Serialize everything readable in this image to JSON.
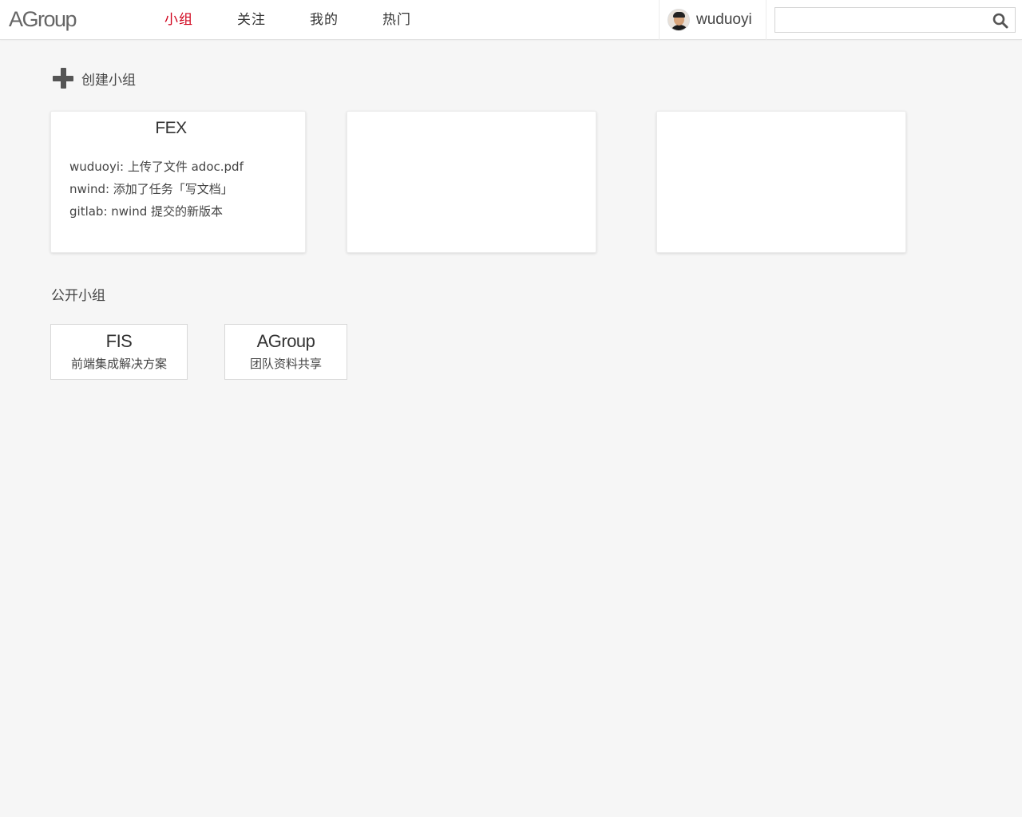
{
  "header": {
    "logo": "AGroup",
    "nav": [
      {
        "label": "小组",
        "active": true
      },
      {
        "label": "关注",
        "active": false
      },
      {
        "label": "我的",
        "active": false
      },
      {
        "label": "热门",
        "active": false
      }
    ],
    "user": {
      "name": "wuduoyi",
      "avatar_icon": "user-avatar"
    },
    "search": {
      "value": "",
      "placeholder": "",
      "icon": "search-icon"
    }
  },
  "create_group": {
    "label": "创建小组",
    "icon": "plus-icon"
  },
  "my_groups": [
    {
      "title": "FEX",
      "activities": [
        "wuduoyi: 上传了文件 adoc.pdf",
        "nwind: 添加了任务「写文档」",
        "gitlab: nwind 提交的新版本"
      ]
    },
    {
      "title": "",
      "activities": []
    },
    {
      "title": "",
      "activities": []
    }
  ],
  "public_groups": {
    "title": "公开小组",
    "items": [
      {
        "name": "FIS",
        "desc": "前端集成解决方案"
      },
      {
        "name": "AGroup",
        "desc": "团队资料共享"
      }
    ]
  },
  "colors": {
    "accent": "#d0021b",
    "background": "#f6f6f6",
    "text": "#333333"
  }
}
